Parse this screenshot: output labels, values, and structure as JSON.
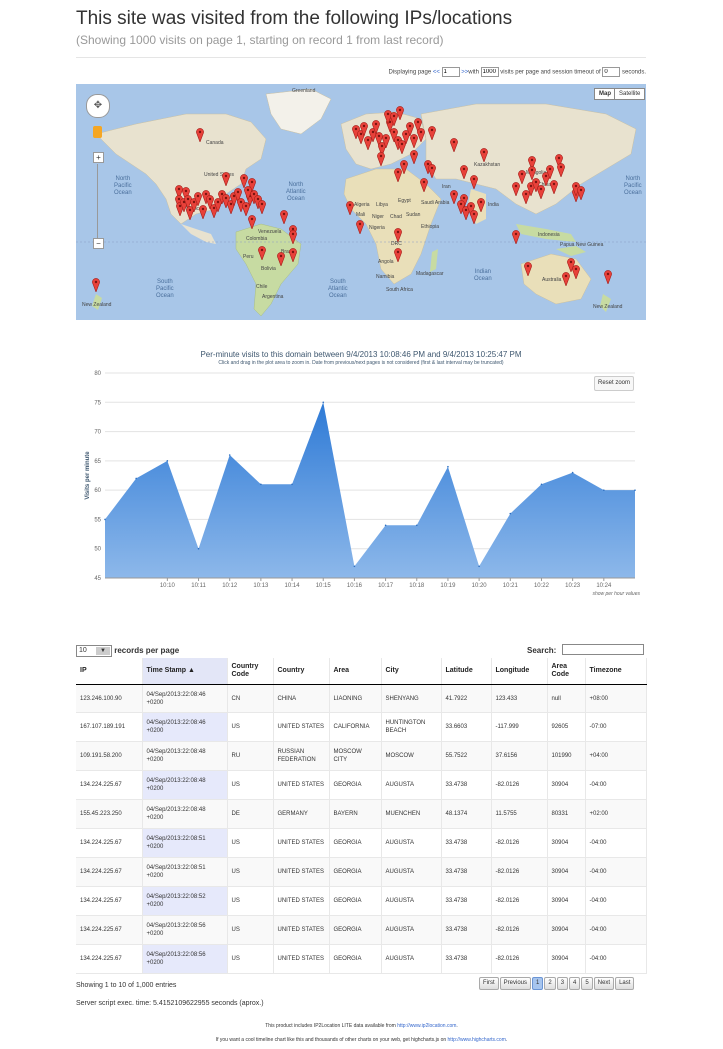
{
  "header": {
    "title": "This site was visited from the following IPs/locations",
    "subtitle": "(Showing 1000 visits on page 1, starting on record 1 from last record)"
  },
  "paging": {
    "prefix": "Displaying page",
    "prev": "<<",
    "page": "1",
    "next": ">>",
    "with": "with",
    "per_page": "1000",
    "mid": "visits per page and session timeout of",
    "timeout": "0",
    "suffix": "seconds."
  },
  "map": {
    "map_button": "Map",
    "satellite_button": "Satellite",
    "labels": [
      {
        "text": "Greenland"
      },
      {
        "text": "Canada"
      },
      {
        "text": "United States"
      },
      {
        "text": "Mexico"
      },
      {
        "text": "Venezuela"
      },
      {
        "text": "Colombia"
      },
      {
        "text": "Peru"
      },
      {
        "text": "Brazil"
      },
      {
        "text": "Bolivia"
      },
      {
        "text": "Chile"
      },
      {
        "text": "Argentina"
      },
      {
        "text": "Algeria"
      },
      {
        "text": "Libya"
      },
      {
        "text": "Egypt"
      },
      {
        "text": "Mali"
      },
      {
        "text": "Niger"
      },
      {
        "text": "Chad"
      },
      {
        "text": "Sudan"
      },
      {
        "text": "Nigeria"
      },
      {
        "text": "Ethiopia"
      },
      {
        "text": "DRC"
      },
      {
        "text": "Angola"
      },
      {
        "text": "Namibia"
      },
      {
        "text": "South Africa"
      },
      {
        "text": "Madagascar"
      },
      {
        "text": "Kazakhstan"
      },
      {
        "text": "Mongolia"
      },
      {
        "text": "China"
      },
      {
        "text": "India"
      },
      {
        "text": "Iran"
      },
      {
        "text": "Saudi Arabia"
      },
      {
        "text": "Indonesia"
      },
      {
        "text": "Papua New Guinea"
      },
      {
        "text": "Australia"
      },
      {
        "text": "New Zealand"
      },
      {
        "text": "New Zealand"
      }
    ],
    "oceans": [
      {
        "text": "North\nPacific\nOcean"
      },
      {
        "text": "North\nAtlantic\nOcean"
      },
      {
        "text": "South\nPacific\nOcean"
      },
      {
        "text": "South\nAtlantic\nOcean"
      },
      {
        "text": "Indian\nOcean"
      },
      {
        "text": "North\nPacific\nOcean"
      }
    ]
  },
  "chart_section": {
    "title": "Per-minute visits to this domain between 9/4/2013 10:08:46 PM and 9/4/2013 10:25:47 PM",
    "subtitle": "Click and drag in the plot area to zoom in. Date from previous/next pages is not considered (first & last interval may be truncated)",
    "reset_zoom": "Reset zoom",
    "show_per_hour": "show per hour values"
  },
  "chart_data": {
    "type": "area",
    "ylabel": "Visits per minute",
    "ylim": [
      45,
      80
    ],
    "yticks": [
      45,
      50,
      55,
      60,
      65,
      70,
      75,
      80
    ],
    "x": [
      "10:08",
      "10:09",
      "10:10",
      "10:11",
      "10:12",
      "10:13",
      "10:14",
      "10:15",
      "10:16",
      "10:17",
      "10:18",
      "10:19",
      "10:20",
      "10:21",
      "10:22",
      "10:23",
      "10:24",
      "10:25"
    ],
    "xtick_labels": [
      "10:10",
      "10:11",
      "10:12",
      "10:13",
      "10:14",
      "10:15",
      "10:16",
      "10:17",
      "10:18",
      "10:19",
      "10:20",
      "10:21",
      "10:22",
      "10:23",
      "10:24"
    ],
    "values": [
      55,
      62,
      65,
      50,
      66,
      61,
      61,
      75,
      47,
      54,
      54,
      64,
      47,
      56,
      61,
      63,
      60,
      60
    ],
    "grid": true,
    "color": "#4f8fd8"
  },
  "table_section": {
    "length_value": "10",
    "length_label": "records per page",
    "search_label": "Search:",
    "search_value": "",
    "columns": [
      "IP",
      "Time Stamp",
      "Country Code",
      "Country",
      "Area",
      "City",
      "Latitude",
      "Longitude",
      "Area Code",
      "Timezone"
    ],
    "rows": [
      [
        "123.246.100.90",
        "04/Sep/2013:22:08:46 +0200",
        "CN",
        "CHINA",
        "LIAONING",
        "SHENYANG",
        "41.7922",
        "123.433",
        "null",
        "+08:00"
      ],
      [
        "167.107.189.191",
        "04/Sep/2013:22:08:46 +0200",
        "US",
        "UNITED STATES",
        "CALIFORNIA",
        "HUNTINGTON BEACH",
        "33.6603",
        "-117.999",
        "92605",
        "-07:00"
      ],
      [
        "109.191.58.200",
        "04/Sep/2013:22:08:48 +0200",
        "RU",
        "RUSSIAN FEDERATION",
        "MOSCOW CITY",
        "MOSCOW",
        "55.7522",
        "37.6156",
        "101990",
        "+04:00"
      ],
      [
        "134.224.225.67",
        "04/Sep/2013:22:08:48 +0200",
        "US",
        "UNITED STATES",
        "GEORGIA",
        "AUGUSTA",
        "33.4738",
        "-82.0126",
        "30904",
        "-04:00"
      ],
      [
        "155.45.223.250",
        "04/Sep/2013:22:08:48 +0200",
        "DE",
        "GERMANY",
        "BAYERN",
        "MUENCHEN",
        "48.1374",
        "11.5755",
        "80331",
        "+02:00"
      ],
      [
        "134.224.225.67",
        "04/Sep/2013:22:08:51 +0200",
        "US",
        "UNITED STATES",
        "GEORGIA",
        "AUGUSTA",
        "33.4738",
        "-82.0126",
        "30904",
        "-04:00"
      ],
      [
        "134.224.225.67",
        "04/Sep/2013:22:08:51 +0200",
        "US",
        "UNITED STATES",
        "GEORGIA",
        "AUGUSTA",
        "33.4738",
        "-82.0126",
        "30904",
        "-04:00"
      ],
      [
        "134.224.225.67",
        "04/Sep/2013:22:08:52 +0200",
        "US",
        "UNITED STATES",
        "GEORGIA",
        "AUGUSTA",
        "33.4738",
        "-82.0126",
        "30904",
        "-04:00"
      ],
      [
        "134.224.225.67",
        "04/Sep/2013:22:08:56 +0200",
        "US",
        "UNITED STATES",
        "GEORGIA",
        "AUGUSTA",
        "33.4738",
        "-82.0126",
        "30904",
        "-04:00"
      ],
      [
        "134.224.225.67",
        "04/Sep/2013:22:08:56 +0200",
        "US",
        "UNITED STATES",
        "GEORGIA",
        "AUGUSTA",
        "33.4738",
        "-82.0126",
        "30904",
        "-04:00"
      ]
    ],
    "info": "Showing 1 to 10 of 1,000 entries",
    "pagination": [
      "First",
      "Previous",
      "1",
      "2",
      "3",
      "4",
      "5",
      "Next",
      "Last"
    ],
    "active_page": "1"
  },
  "footer": {
    "server_time": "Server script exec. time: 5.4152109622955 seconds (aprox.)",
    "ip2_text": "This product includes IP2Location LITE data available from",
    "ip2_link": "http://www.ip2location.com",
    "hc_text": "If you want a cool timeline chart like this and thousands of other charts on your web, get highcharts.js on",
    "hc_link": "http://www.highcharts.com"
  }
}
